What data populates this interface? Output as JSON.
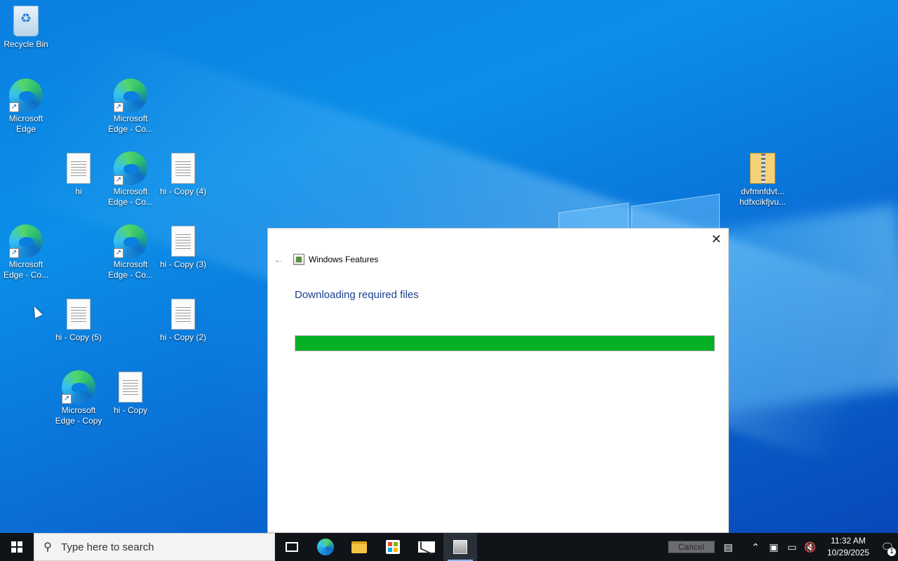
{
  "desktop": {
    "icons": [
      {
        "label": "Recycle Bin",
        "type": "recycle-bin"
      },
      {
        "label": "Microsoft Edge",
        "type": "edge"
      },
      {
        "label": "Microsoft Edge - Co...",
        "type": "edge"
      },
      {
        "label": "hi",
        "type": "document"
      },
      {
        "label": "Microsoft Edge - Co...",
        "type": "edge"
      },
      {
        "label": "hi - Copy (4)",
        "type": "document"
      },
      {
        "label": "dvfmnfdvt... hdfxcikfjvu...",
        "type": "zip"
      },
      {
        "label": "Microsoft Edge - Co...",
        "type": "edge"
      },
      {
        "label": "Microsoft Edge - Co...",
        "type": "edge"
      },
      {
        "label": "hi - Copy (3)",
        "type": "document"
      },
      {
        "label": "hi - Copy (5)",
        "type": "document"
      },
      {
        "label": "hi - Copy (2)",
        "type": "document"
      },
      {
        "label": "Microsoft Edge - Copy",
        "type": "edge"
      },
      {
        "label": "hi - Copy",
        "type": "document"
      }
    ]
  },
  "dialog": {
    "title": "Windows Features",
    "heading": "Downloading required files",
    "progress_fraction": 1.0,
    "progress_color": "#06b025",
    "close_icon": "close-icon",
    "back_icon": "back-arrow-icon"
  },
  "taskbar": {
    "search_placeholder": "Type here to search",
    "apps": [
      "task-view-icon",
      "edge-icon",
      "file-explorer-icon",
      "store-icon",
      "mail-icon",
      "windows-features-icon"
    ],
    "tray_cancel_label": "Cancel",
    "time": "11:32 AM",
    "date": "10/29/2025",
    "notification_count": "1"
  },
  "colors": {
    "accent": "#0a7fe0",
    "taskbar": "#101418",
    "heading": "#1a3f8c"
  }
}
